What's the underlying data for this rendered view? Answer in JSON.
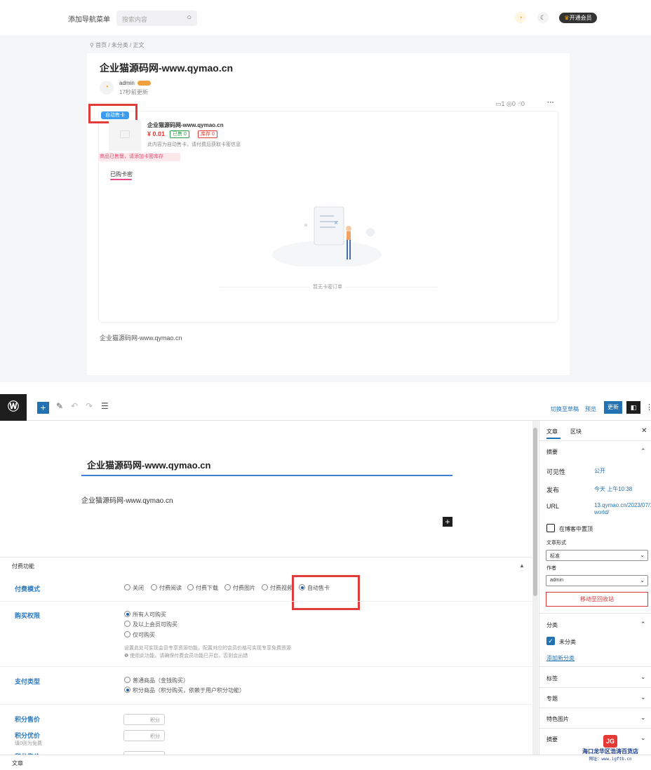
{
  "site": {
    "nav_link": "添加导航菜单",
    "search_placeholder": "搜索内容",
    "vip_button": "开通会员",
    "breadcrumb": [
      "首页",
      "未分类",
      "正文"
    ],
    "post_title": "企业猫源码网-www.qymao.cn",
    "author": "admin",
    "updated": "17秒前更新",
    "stats": {
      "comments": "1",
      "views": "0",
      "likes": "0"
    },
    "product": {
      "tag": "自动售卡",
      "name": "企业猫源码网-www.qymao.cn",
      "price": "¥ 0.01",
      "sold": "已售 0",
      "stock": "库存 0",
      "description": "此内容为自动售卡，请付费后获取卡密信息",
      "soldout_notice": "商品已售罄，请添加卡密库存",
      "tab": "已购卡密",
      "empty": "暂无卡密订单"
    },
    "body_text": "企业猫源码网-www.qymao.cn"
  },
  "editor": {
    "toolbar": {
      "switch_draft": "切换至草稿",
      "preview": "预览",
      "update": "更新"
    },
    "title": "企业猫源码网-www.qymao.cn",
    "body": "企业猫源码网-www.qymao.cn",
    "metabox": {
      "heading": "付费功能",
      "pay_mode": {
        "label": "付费模式",
        "options": [
          "关闭",
          "付费阅读",
          "付费下载",
          "付费图片",
          "付费视频",
          "自动售卡"
        ],
        "selected": "自动售卡"
      },
      "buy_permission": {
        "label": "购买权限",
        "options": [
          "所有人可购买",
          "及以上会员可购买",
          "仅可购买"
        ],
        "help1": "设置此处可实现会员专享资源功能，配置对应的会员价格可实现专享免费资源",
        "help2": "使用此功能，请确保付费会员功能已开启，否则会出错"
      },
      "pay_type": {
        "label": "支付类型",
        "options": [
          "普通商品（金钱购买）",
          "积分商品（积分购买，依赖于用户积分功能）"
        ],
        "selected": "积分商品（积分购买，依赖于用户积分功能）"
      },
      "points_price": {
        "label": "积分售价",
        "unit": "积分"
      },
      "points_discount": {
        "label": "积分优价",
        "sub": "填0则为免费",
        "unit": "积分"
      },
      "points_price2": {
        "label": "积分售价"
      }
    },
    "sidebar": {
      "tabs": [
        "文章",
        "区块"
      ],
      "summary": "摘要",
      "visibility": {
        "key": "可见性",
        "value": "公开"
      },
      "publish": {
        "key": "发布",
        "value": "今天 上午10:38"
      },
      "url": {
        "key": "URL",
        "value": "13.qymao.cn/2023/07/19/hello-world/"
      },
      "sticky": "在博客中置顶",
      "format_label": "文章形式",
      "format_value": "标准",
      "author_label": "作者",
      "author_value": "admin",
      "trash": "移动至回收站",
      "categories": "分类",
      "category_item": "未分类",
      "add_category": "添加新分类",
      "tags": "标签",
      "topics": "专题",
      "featured": "特色图片",
      "excerpt": "摘要"
    },
    "status_bar": "文章"
  },
  "watermark": {
    "logo": "JG",
    "name": "海口龙华区浩涛百货店",
    "url": "网址：www.igftb.cn"
  }
}
